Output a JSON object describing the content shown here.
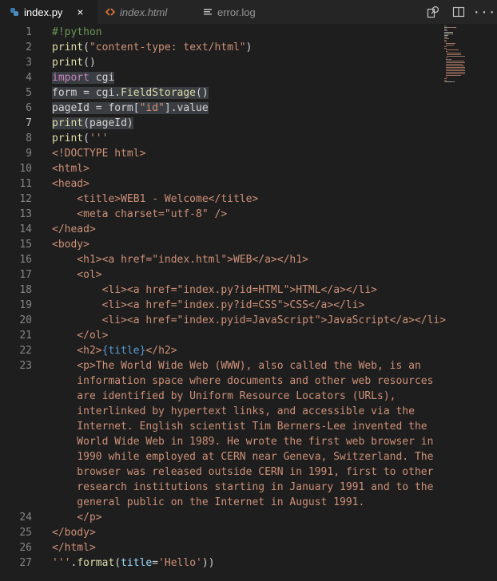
{
  "tabs": [
    {
      "label": "index.py",
      "icon": "python-file-icon",
      "active": true,
      "close": "×"
    },
    {
      "label": "index.html",
      "icon": "html-file-icon",
      "active": false
    },
    {
      "label": "error.log",
      "icon": "log-file-icon",
      "active": false
    }
  ],
  "actions": [
    "open-changes-icon",
    "split-editor-icon",
    "more-actions-icon"
  ],
  "more_label": "···",
  "colors": {
    "background": "#1e1e1e",
    "tabbar": "#252526",
    "line_number": "#858585",
    "comment": "#6a9955",
    "function": "#dcdcaa",
    "string": "#ce9178",
    "keyword": "#c586c0",
    "variable": "#9cdcfe",
    "plain": "#d4d4d4",
    "brace": "#569cd6",
    "selection": "#3a3d41"
  },
  "editor": {
    "current_line": 7,
    "lines": [
      {
        "n": "1",
        "tokens": [
          [
            "comment",
            "#!python"
          ]
        ]
      },
      {
        "n": "2",
        "tokens": [
          [
            "func",
            "print"
          ],
          [
            "plain",
            "("
          ],
          [
            "str",
            "\"content-type: text/html\""
          ],
          [
            "plain",
            ")"
          ]
        ]
      },
      {
        "n": "3",
        "tokens": [
          [
            "func",
            "print"
          ],
          [
            "plain",
            "()"
          ]
        ]
      },
      {
        "n": "4",
        "hl": true,
        "tokens": [
          [
            "kw",
            "import"
          ],
          [
            "plain",
            " cgi"
          ]
        ]
      },
      {
        "n": "5",
        "hl": true,
        "tokens": [
          [
            "plain",
            "form = cgi."
          ],
          [
            "func",
            "FieldStorage"
          ],
          [
            "plain",
            "()"
          ]
        ]
      },
      {
        "n": "6",
        "hl": true,
        "tokens": [
          [
            "plain",
            "pageId = form["
          ],
          [
            "str",
            "\"id\""
          ],
          [
            "plain",
            "].value"
          ]
        ]
      },
      {
        "n": "7",
        "hl": true,
        "tokens": [
          [
            "func",
            "print"
          ],
          [
            "plain",
            "(pageId)"
          ]
        ]
      },
      {
        "n": "8",
        "tokens": [
          [
            "func",
            "print"
          ],
          [
            "plain",
            "("
          ],
          [
            "str",
            "'''"
          ]
        ]
      },
      {
        "n": "9",
        "tokens": [
          [
            "str",
            "<!DOCTYPE html>"
          ]
        ]
      },
      {
        "n": "10",
        "tokens": [
          [
            "str",
            "<html>"
          ]
        ]
      },
      {
        "n": "11",
        "tokens": [
          [
            "str",
            "<head>"
          ]
        ]
      },
      {
        "n": "12",
        "tokens": [
          [
            "str",
            "    <title>WEB1 - Welcome</title>"
          ]
        ]
      },
      {
        "n": "13",
        "tokens": [
          [
            "str",
            "    <meta charset=\"utf-8\" />"
          ]
        ]
      },
      {
        "n": "14",
        "tokens": [
          [
            "str",
            "</head>"
          ]
        ]
      },
      {
        "n": "15",
        "tokens": [
          [
            "str",
            "<body>"
          ]
        ]
      },
      {
        "n": "16",
        "tokens": [
          [
            "str",
            "    <h1><a href=\"index.html\">WEB</a></h1>"
          ]
        ]
      },
      {
        "n": "17",
        "tokens": [
          [
            "str",
            "    <ol>"
          ]
        ]
      },
      {
        "n": "18",
        "tokens": [
          [
            "str",
            "        <li><a href=\"index.py?id=HTML\">HTML</a></li>"
          ]
        ]
      },
      {
        "n": "19",
        "tokens": [
          [
            "str",
            "        <li><a href=\"index.py?id=CSS\">CSS</a></li>"
          ]
        ]
      },
      {
        "n": "20",
        "tokens": [
          [
            "str",
            "        <li><a href=\"index.pyid=JavaScript\">JavaScript</a></li>"
          ]
        ]
      },
      {
        "n": "21",
        "tokens": [
          [
            "str",
            "    </ol>"
          ]
        ]
      },
      {
        "n": "22",
        "tokens": [
          [
            "str",
            "    <h2>"
          ],
          [
            "brace",
            "{title}"
          ],
          [
            "str",
            "</h2>"
          ]
        ]
      },
      {
        "n": "23",
        "tokens": [
          [
            "str",
            "    <p>The World Wide Web (WWW), also called the Web, is an"
          ]
        ]
      },
      {
        "n": "",
        "tokens": [
          [
            "str",
            "    information space where documents and other web resources"
          ]
        ]
      },
      {
        "n": "",
        "tokens": [
          [
            "str",
            "    are identified by Uniform Resource Locators (URLs),"
          ]
        ]
      },
      {
        "n": "",
        "tokens": [
          [
            "str",
            "    interlinked by hypertext links, and accessible via the"
          ]
        ]
      },
      {
        "n": "",
        "tokens": [
          [
            "str",
            "    Internet. English scientist Tim Berners-Lee invented the"
          ]
        ]
      },
      {
        "n": "",
        "tokens": [
          [
            "str",
            "    World Wide Web in 1989. He wrote the first web browser in"
          ]
        ]
      },
      {
        "n": "",
        "tokens": [
          [
            "str",
            "    1990 while employed at CERN near Geneva, Switzerland. The"
          ]
        ]
      },
      {
        "n": "",
        "tokens": [
          [
            "str",
            "    browser was released outside CERN in 1991, first to other"
          ]
        ]
      },
      {
        "n": "",
        "tokens": [
          [
            "str",
            "    research institutions starting in January 1991 and to the"
          ]
        ]
      },
      {
        "n": "",
        "tokens": [
          [
            "str",
            "    general public on the Internet in August 1991."
          ]
        ]
      },
      {
        "n": "24",
        "tokens": [
          [
            "str",
            "    </p>"
          ]
        ]
      },
      {
        "n": "25",
        "tokens": [
          [
            "str",
            "</body>"
          ]
        ]
      },
      {
        "n": "26",
        "tokens": [
          [
            "str",
            "</html>"
          ]
        ]
      },
      {
        "n": "27",
        "tokens": [
          [
            "str",
            "'''"
          ],
          [
            "plain",
            "."
          ],
          [
            "func",
            "format"
          ],
          [
            "plain",
            "("
          ],
          [
            "var",
            "title"
          ],
          [
            "plain",
            "="
          ],
          [
            "str",
            "'Hello'"
          ],
          [
            "plain",
            "))"
          ]
        ]
      }
    ]
  }
}
